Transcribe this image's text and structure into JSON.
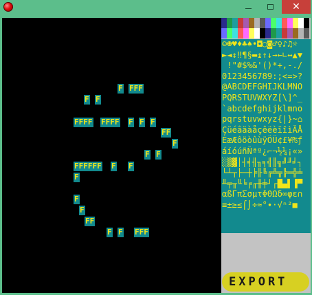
{
  "window": {
    "minimize_icon": "minimize-icon",
    "maximize_icon": "maximize-icon",
    "close_label": "✕"
  },
  "canvas_tiles": [
    {
      "text": "F"
    },
    {
      "text": "FFF"
    },
    {
      "text": "F"
    },
    {
      "text": "F"
    },
    {
      "text": "FFFF"
    },
    {
      "text": "FFFF"
    },
    {
      "text": "F"
    },
    {
      "text": "F"
    },
    {
      "text": "F"
    },
    {
      "text": "FF"
    },
    {
      "text": "F"
    },
    {
      "text": "F"
    },
    {
      "text": "F"
    },
    {
      "text": "FFFFFF"
    },
    {
      "text": "F"
    },
    {
      "text": "F"
    },
    {
      "text": "F"
    },
    {
      "text": "F"
    },
    {
      "text": "F"
    },
    {
      "text": "FF"
    },
    {
      "text": "F"
    },
    {
      "text": "F"
    },
    {
      "text": "FFF"
    }
  ],
  "palette_colors": [
    "#2a2a8c",
    "#1f9a4a",
    "#1e9e9e",
    "#c83a3a",
    "#a65ab0",
    "#9a6a20",
    "#b4b4b4",
    "#5a5a5a",
    "#6a6aff",
    "#4aff6a",
    "#3ee0e0",
    "#ff5a5a",
    "#ff6aff",
    "#ffff5a",
    "#ffffff",
    "#000000"
  ],
  "charmap_rows": [
    "☺☻♥♦♣♠•◘○◙♂♀♪♫☼",
    "►◄↕‼¶§▬↨↑↓→←∟↔▲▼",
    " !\"#$%&'()*+,-./",
    "0123456789:;<=>?",
    "@ABCDEFGHIJKLMNO",
    "PQRSTUVWXYZ[\\]^_",
    "`abcdefghijklmno",
    "pqrstuvwxyz{|}~⌂",
    "ÇüéâäàåçêëèïîìÄÅ",
    "ÉæÆôöòûùÿÖÜ¢£¥₧ƒ",
    "áíóúñÑªº¿⌐¬½¼¡«»",
    "░▒▓│┤╡╢╖╕╣║╗╝╜╛┐",
    "└┴┬├─┼╞╟╚╔╩╦╠═╬╧",
    "╨╤╥╙╘╒╓╫╪┘┌█▄▌▐▀",
    "αßΓπΣσµτΦΘΩδ∞φε∩",
    "≡±≥≤⌠⌡÷≈°∙·√ⁿ²■ "
  ],
  "export_label": "EXPORT"
}
